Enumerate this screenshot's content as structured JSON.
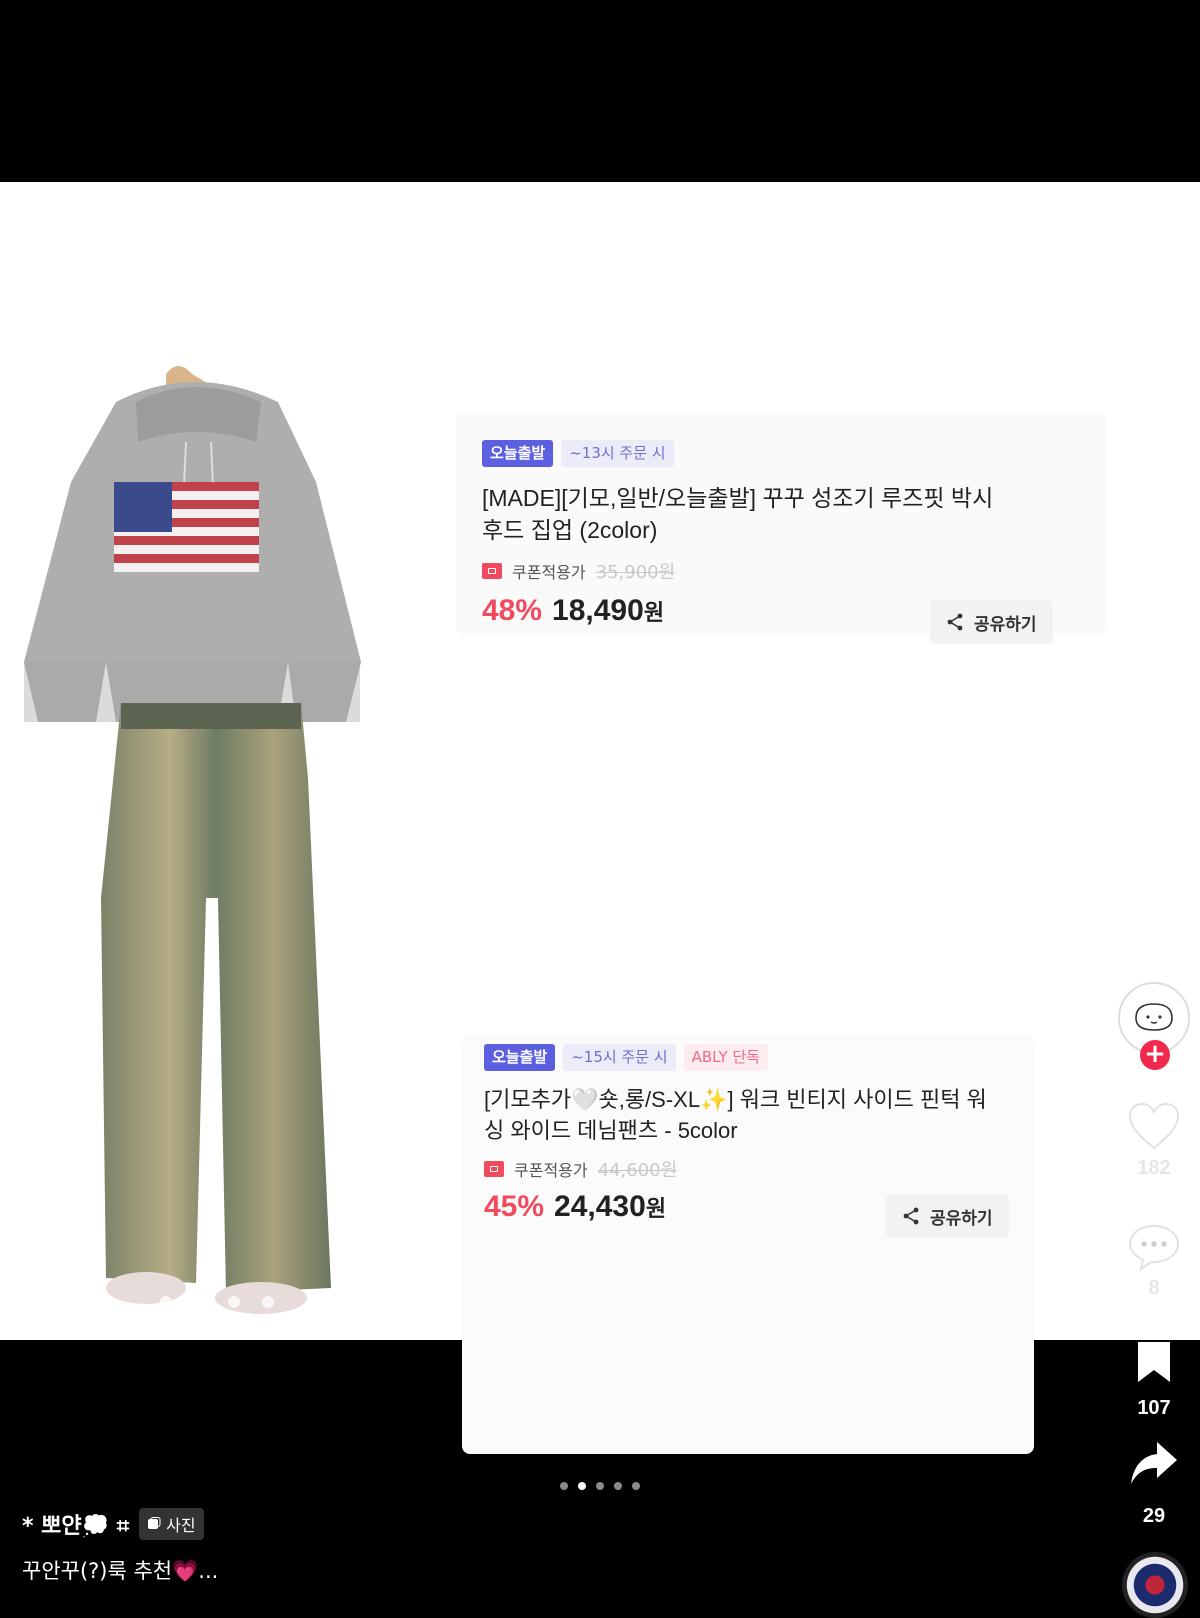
{
  "products": [
    {
      "tags": [
        "오늘출발",
        "~13시 주문 시"
      ],
      "title": "[MADE][기모,일반/오늘출발] 꾸꾸 성조기 루즈핏 박시 후드 집업 (2color)",
      "title_line1": "[MADE][기모,일반/오늘출발] 꾸꾸 성조기 루즈핏 박시",
      "title_line2": "후드 집업 (2color)",
      "coupon_label": "쿠폰적용가",
      "original_price": "35,900원",
      "discount": "48%",
      "price": "18,490",
      "currency": "원",
      "share_label": "공유하기"
    },
    {
      "tags": [
        "오늘출발",
        "~15시 주문 시",
        "ABLY 단독"
      ],
      "title": "[기모추가🤍숏,롱/S-XL✨] 워크 빈티지 사이드 핀턱 워싱 와이드 데님팬츠 - 5color",
      "title_line1": "[기모추가🤍숏,롱/S-XL✨] 워크 빈티지 사이드 핀턱 워",
      "title_line2": "싱 와이드 데님팬츠 - 5color",
      "coupon_label": "쿠폰적용가",
      "original_price": "44,600원",
      "discount": "45%",
      "price": "24,430",
      "currency": "원",
      "share_label": "공유하기"
    }
  ],
  "actions": {
    "likes": "182",
    "comments": "8",
    "saves": "107",
    "shares": "29",
    "follow_symbol": "+"
  },
  "post": {
    "author": "* 뽀얀💭 ⌗",
    "photo_badge": "사진",
    "caption": "꾸안꾸(?)룩 추천💗..."
  },
  "carousel": {
    "count": 5,
    "active_index": 1
  },
  "colors": {
    "accent_red": "#f04a5e",
    "badge_blue": "#5b5fe0",
    "follow_red": "#f0294d"
  }
}
